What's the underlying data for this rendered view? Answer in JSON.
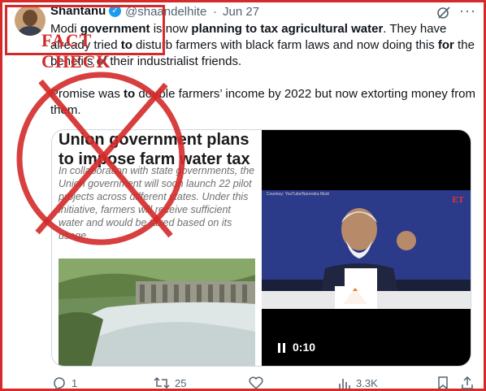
{
  "tweet": {
    "author_name": "Shantanu",
    "handle": "@shaandelhite",
    "separator": "·",
    "date": "Jun 27",
    "paragraph_1_parts": [
      "Modi ",
      "government",
      " is now ",
      "planning to tax agricultural water",
      ". They have already tried ",
      "to",
      " disturb farmers with black farm laws and now doing this ",
      "for",
      " the benefits of their industrialist friends."
    ],
    "paragraph_2_parts": [
      "Promise was ",
      "to",
      " double farmers’ income by 2022 but now extorting money from them."
    ]
  },
  "stamp": {
    "label": "FACT CHECK"
  },
  "media": {
    "article_title": "Union government plans to impose farm water tax",
    "article_body": "In collaboration with state governments, the Union government will soon launch 22 pilot projects across different states. Under this initiative, farmers will receive sufficient water and would be taxed based on its usage.",
    "video_caption": "Courtesy: YouTube/Narendra Modi",
    "video_brand": "ET",
    "video_time": "0:10"
  },
  "actions": {
    "replies": "1",
    "retweets": "25",
    "likes": "",
    "views": "3.3K"
  },
  "colors": {
    "stamp_red": "#d42a2a",
    "verified_blue": "#1d9bf0",
    "muted": "#536471"
  },
  "icons": [
    "grok-icon",
    "more-icon",
    "verified-icon",
    "reply-icon",
    "retweet-icon",
    "like-icon",
    "views-icon",
    "bookmark-icon",
    "share-icon",
    "pause-icon"
  ]
}
